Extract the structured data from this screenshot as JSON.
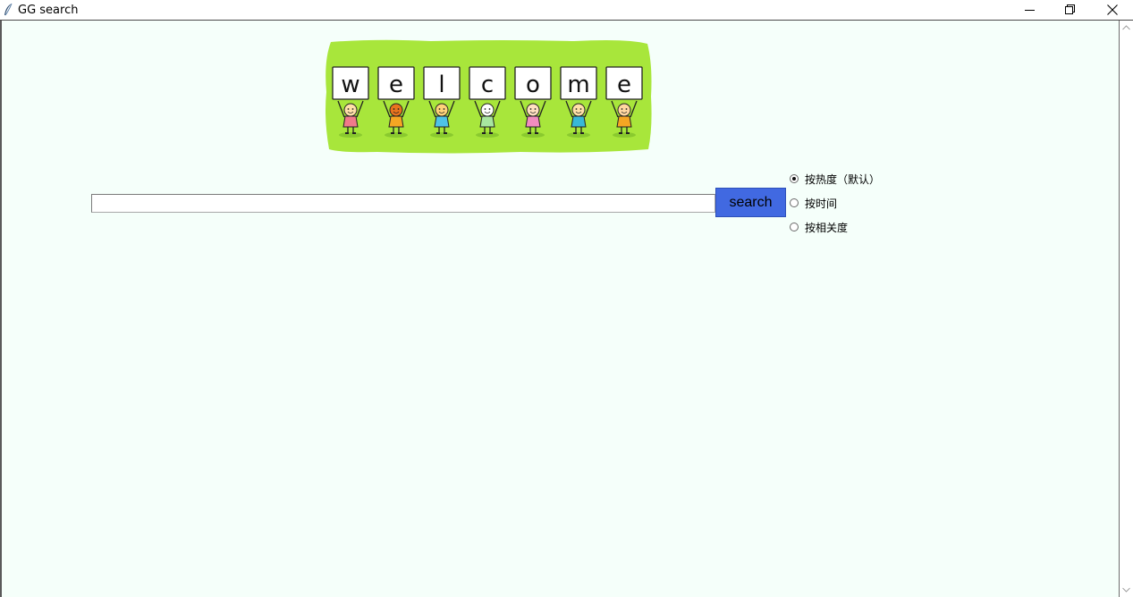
{
  "window": {
    "title": "GG search",
    "minimize_icon": "minimize-icon",
    "restore_icon": "restore-icon",
    "close_icon": "close-icon"
  },
  "banner": {
    "word": "welcome",
    "letters": [
      "w",
      "e",
      "l",
      "c",
      "o",
      "m",
      "e"
    ],
    "background_color": "#a8e63b"
  },
  "search": {
    "input_value": "",
    "button_label": "search",
    "button_color": "#4169e1"
  },
  "sort_options": [
    {
      "label": "按热度（默认）",
      "checked": true
    },
    {
      "label": "按时间",
      "checked": false
    },
    {
      "label": "按相关度",
      "checked": false
    }
  ],
  "colors": {
    "client_background": "#f5fffa"
  }
}
